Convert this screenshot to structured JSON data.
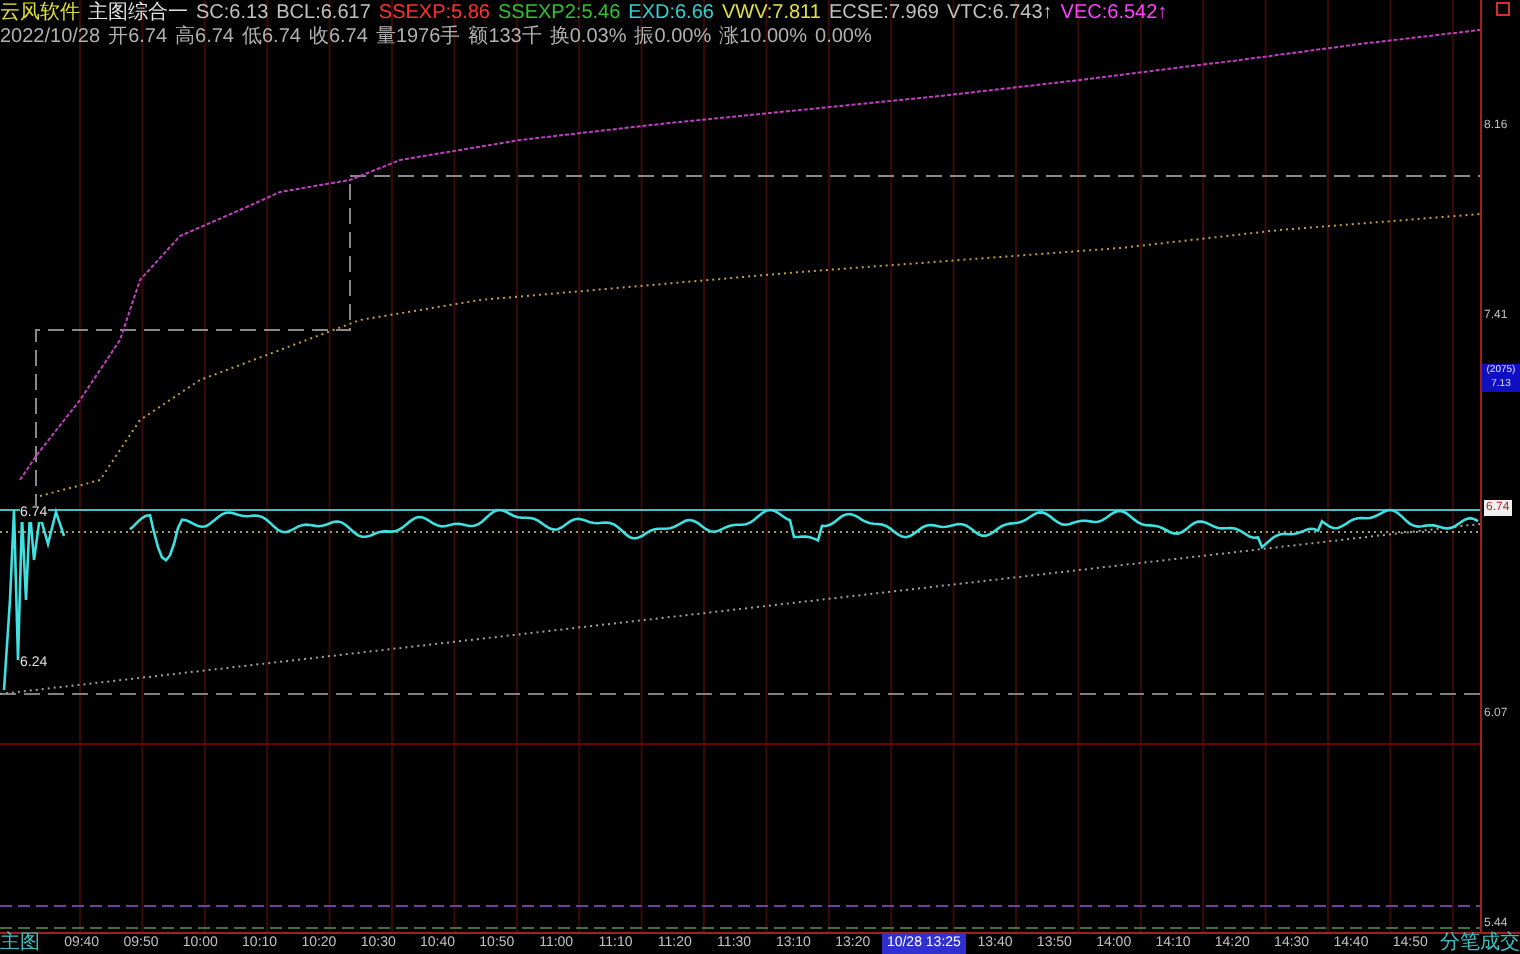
{
  "header": {
    "title": "云风软件",
    "indicator": "主图综合一",
    "values": [
      {
        "text": "SC:6.13",
        "color": "#c0c0c0"
      },
      {
        "text": "BCL:6.617",
        "color": "#c0c0c0"
      },
      {
        "text": "SSEXP:5.86",
        "color": "#ff3030"
      },
      {
        "text": "SSEXP2:5.46",
        "color": "#30c030"
      },
      {
        "text": "EXD:6.66",
        "color": "#30d0d0"
      },
      {
        "text": "VWV:7.811",
        "color": "#e0e040"
      },
      {
        "text": "ECSE:7.969",
        "color": "#c0c0c0"
      },
      {
        "text": "VTC:6.743↑",
        "color": "#c0c0c0"
      },
      {
        "text": "VEC:6.542↑",
        "color": "#ff40ff"
      }
    ],
    "bar_info": [
      "2022/10/28",
      "开6.74",
      "高6.74",
      "低6.74",
      "收6.74",
      "量1976手",
      "额133千",
      "换0.03%",
      "振0.00%",
      "涨10.00%",
      "0.00%"
    ]
  },
  "price_axis": [
    {
      "text": "8.16",
      "kind": "tick"
    },
    {
      "text": "7.41",
      "kind": "tick"
    },
    {
      "text": "6.74",
      "kind": "current"
    },
    {
      "text": "6.07",
      "kind": "tick"
    },
    {
      "text": "5.44",
      "kind": "tick"
    }
  ],
  "marker": {
    "code": "(2075)",
    "price": "7.13"
  },
  "chart_labels": [
    "6.74",
    "6.24"
  ],
  "time_axis": {
    "left_label": "主图",
    "right_label": "分笔成交",
    "ticks": [
      {
        "label": "09:40",
        "selected": false
      },
      {
        "label": "09:50",
        "selected": false
      },
      {
        "label": "10:00",
        "selected": false
      },
      {
        "label": "10:10",
        "selected": false
      },
      {
        "label": "10:20",
        "selected": false
      },
      {
        "label": "10:30",
        "selected": false
      },
      {
        "label": "10:40",
        "selected": false
      },
      {
        "label": "10:50",
        "selected": false
      },
      {
        "label": "11:00",
        "selected": false
      },
      {
        "label": "11:10",
        "selected": false
      },
      {
        "label": "11:20",
        "selected": false
      },
      {
        "label": "11:30",
        "selected": false
      },
      {
        "label": "13:10",
        "selected": false
      },
      {
        "label": "13:20",
        "selected": false
      },
      {
        "label": "10/28 13:25",
        "selected": true
      },
      {
        "label": "13:40",
        "selected": false
      },
      {
        "label": "13:50",
        "selected": false
      },
      {
        "label": "14:00",
        "selected": false
      },
      {
        "label": "14:10",
        "selected": false
      },
      {
        "label": "14:20",
        "selected": false
      },
      {
        "label": "14:30",
        "selected": false
      },
      {
        "label": "14:40",
        "selected": false
      },
      {
        "label": "14:50",
        "selected": false
      }
    ]
  }
}
